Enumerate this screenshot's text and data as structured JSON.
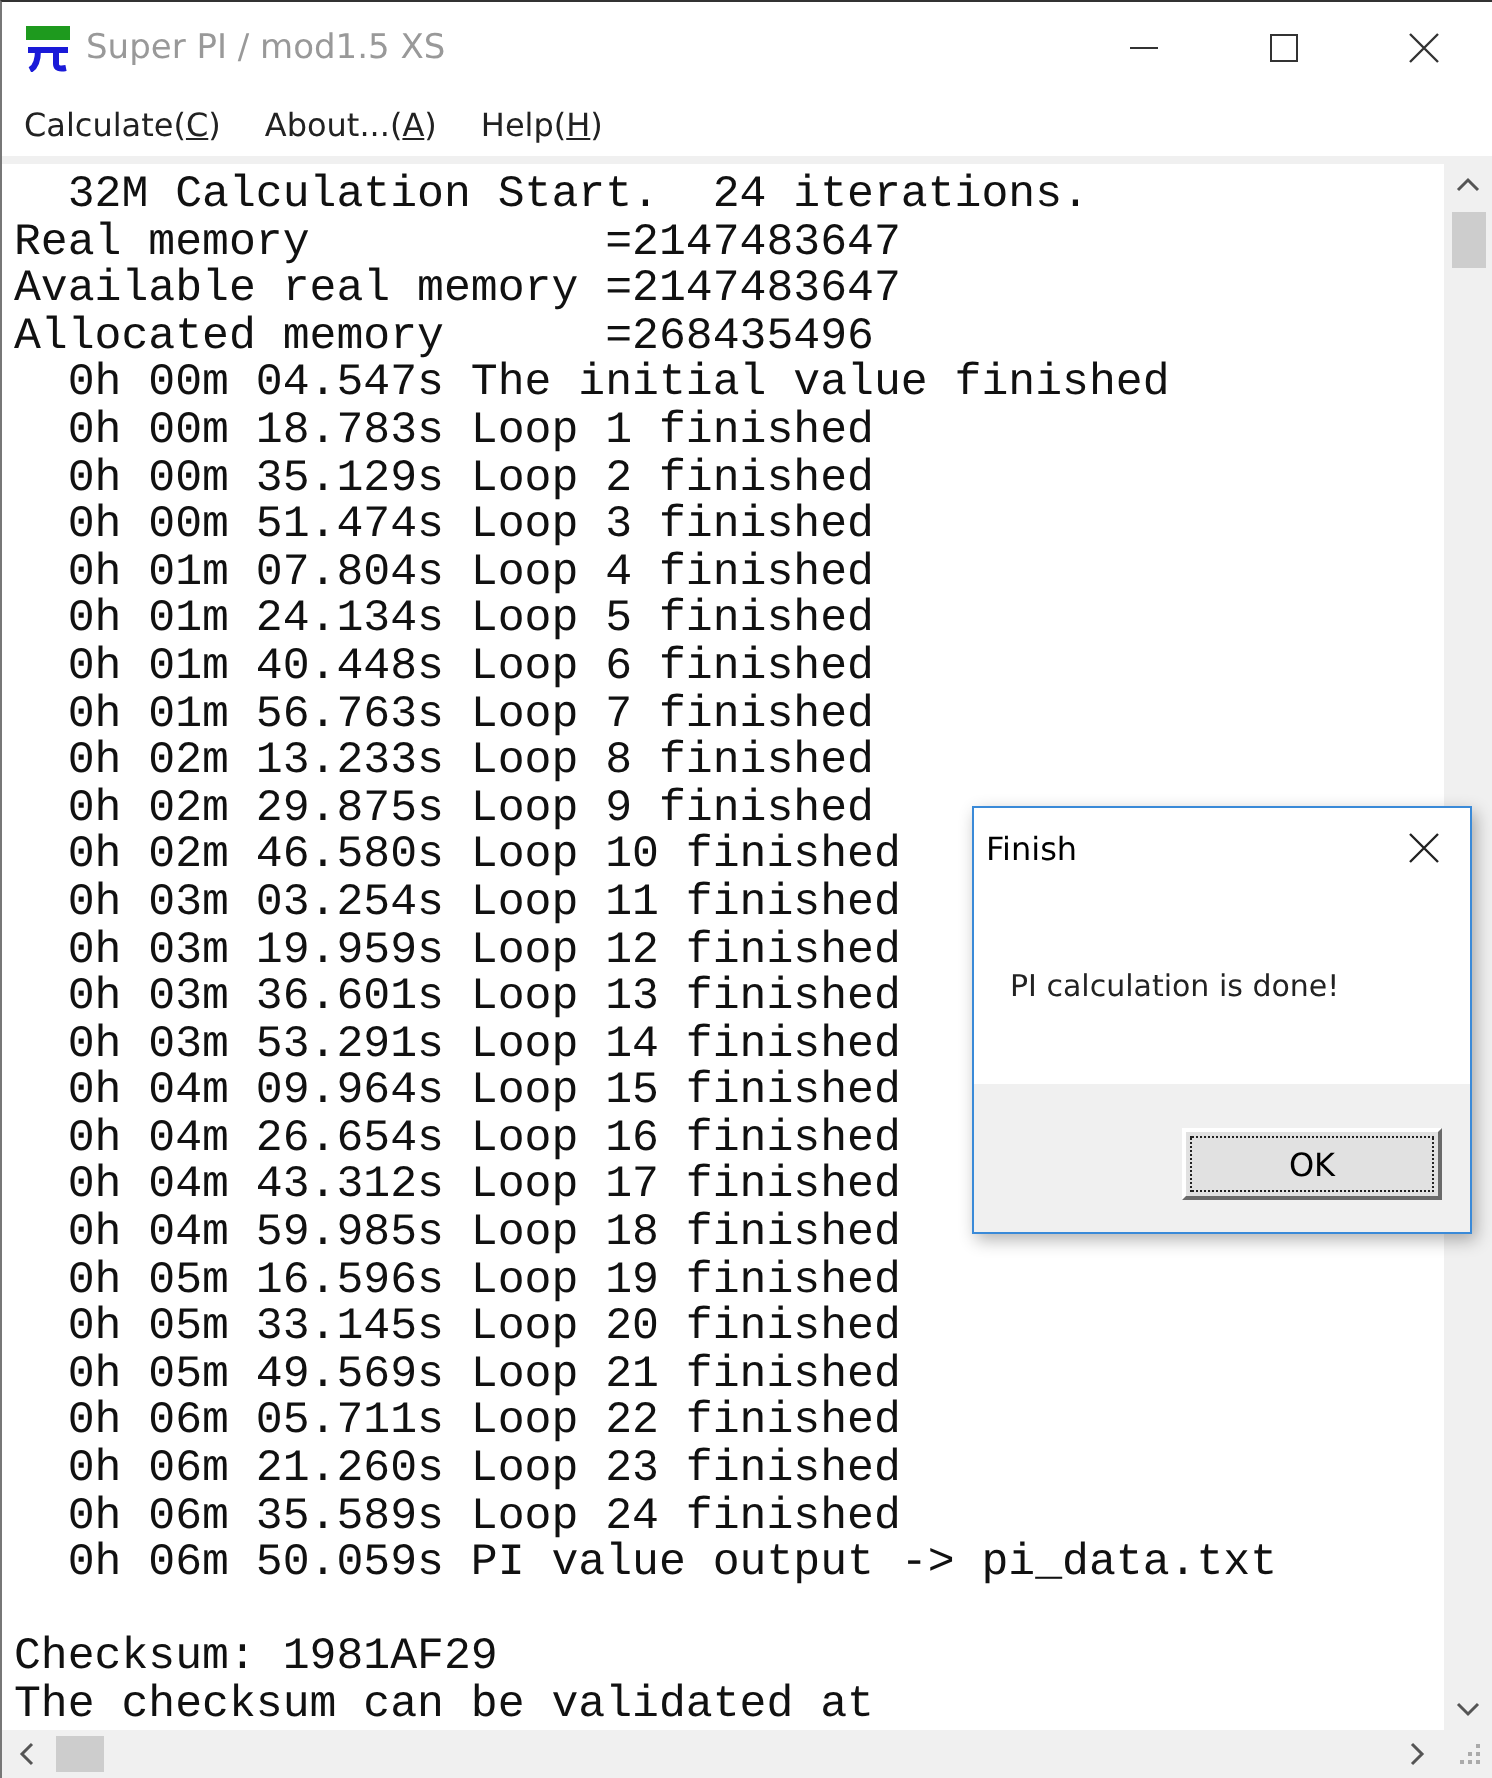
{
  "window": {
    "title": "Super PI / mod1.5 XS"
  },
  "menu": [
    {
      "before": "Calculate(",
      "key": "C",
      "after": ")"
    },
    {
      "before": "About...(",
      "key": "A",
      "after": ")"
    },
    {
      "before": "Help(",
      "key": "H",
      "after": ")"
    }
  ],
  "output_lines": [
    "  32M Calculation Start.  24 iterations.",
    "Real memory           =2147483647",
    "Available real memory =2147483647",
    "Allocated memory      =268435496",
    "  0h 00m 04.547s The initial value finished",
    "  0h 00m 18.783s Loop 1 finished",
    "  0h 00m 35.129s Loop 2 finished",
    "  0h 00m 51.474s Loop 3 finished",
    "  0h 01m 07.804s Loop 4 finished",
    "  0h 01m 24.134s Loop 5 finished",
    "  0h 01m 40.448s Loop 6 finished",
    "  0h 01m 56.763s Loop 7 finished",
    "  0h 02m 13.233s Loop 8 finished",
    "  0h 02m 29.875s Loop 9 finished",
    "  0h 02m 46.580s Loop 10 finished",
    "  0h 03m 03.254s Loop 11 finished",
    "  0h 03m 19.959s Loop 12 finished",
    "  0h 03m 36.601s Loop 13 finished",
    "  0h 03m 53.291s Loop 14 finished",
    "  0h 04m 09.964s Loop 15 finished",
    "  0h 04m 26.654s Loop 16 finished",
    "  0h 04m 43.312s Loop 17 finished",
    "  0h 04m 59.985s Loop 18 finished",
    "  0h 05m 16.596s Loop 19 finished",
    "  0h 05m 33.145s Loop 20 finished",
    "  0h 05m 49.569s Loop 21 finished",
    "  0h 06m 05.711s Loop 22 finished",
    "  0h 06m 21.260s Loop 23 finished",
    "  0h 06m 35.589s Loop 24 finished",
    "  0h 06m 50.059s PI value output -> pi_data.txt"
  ],
  "summary_lines": [
    "Checksum: 1981AF29",
    "The checksum can be validated at"
  ],
  "dialog": {
    "title": "Finish",
    "message": "PI calculation is done!",
    "button": {
      "label": "OK",
      "focused": true
    }
  }
}
